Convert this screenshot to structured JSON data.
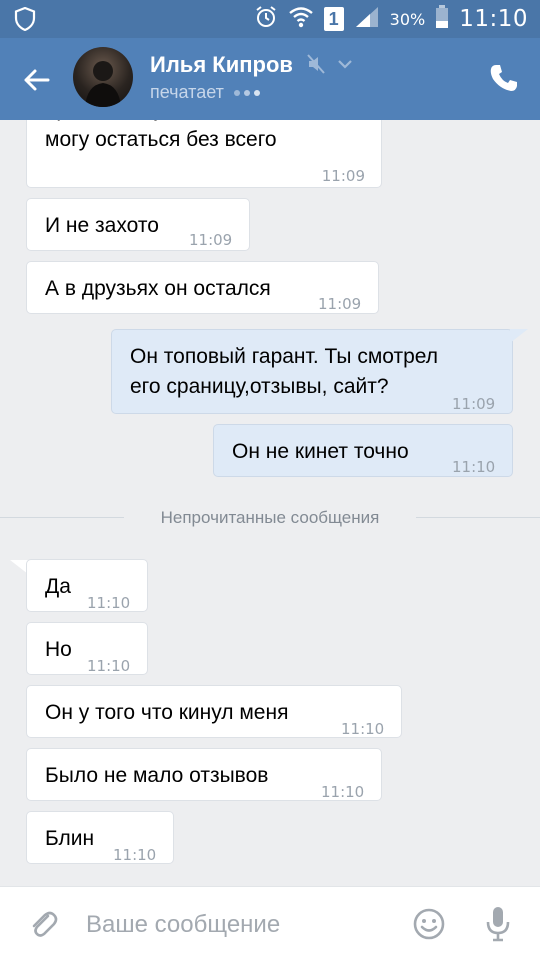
{
  "status_bar": {
    "battery_percent": "30%",
    "time": "11:10",
    "sim_label": "1"
  },
  "header": {
    "contact_name": "Илья Кипров",
    "typing_status": "печатает"
  },
  "messages": [
    {
      "text": "пришел в чувство что снять\nмогу остаться без всего",
      "time": "11:09",
      "direction": "in"
    },
    {
      "text": "И не захото",
      "time": "11:09",
      "direction": "in"
    },
    {
      "text": "А в друзьях он остался",
      "time": "11:09",
      "direction": "in"
    },
    {
      "text": "Он топовый гарант. Ты смотрел\nего сраницу,отзывы, сайт?",
      "time": "11:09",
      "direction": "out"
    },
    {
      "text": "Он не кинет точно",
      "time": "11:10",
      "direction": "out"
    },
    {
      "text": "Да",
      "time": "11:10",
      "direction": "in"
    },
    {
      "text": "Но",
      "time": "11:10",
      "direction": "in"
    },
    {
      "text": "Он у того что кинул меня",
      "time": "11:10",
      "direction": "in"
    },
    {
      "text": "Было не мало отзывов",
      "time": "11:10",
      "direction": "in"
    },
    {
      "text": "Блин",
      "time": "11:10",
      "direction": "in"
    }
  ],
  "unread_divider": "Непрочитанные сообщения",
  "composer": {
    "placeholder": "Ваше сообщение"
  },
  "icons": {
    "shield": "shield-icon",
    "alarm": "alarm-icon",
    "wifi": "wifi-icon",
    "signal": "signal-icon",
    "battery": "battery-icon",
    "back": "back-arrow-icon",
    "mute": "mute-icon",
    "chevron": "chevron-down-icon",
    "phone": "phone-icon",
    "attach": "paperclip-icon",
    "emoji": "smiley-icon",
    "mic": "microphone-icon"
  },
  "colors": {
    "status_bar": "#4a76a8",
    "header": "#5181b8",
    "chat_bg": "#edeef0",
    "outgoing_bubble": "#dfeaf7",
    "incoming_bubble": "#ffffff"
  }
}
